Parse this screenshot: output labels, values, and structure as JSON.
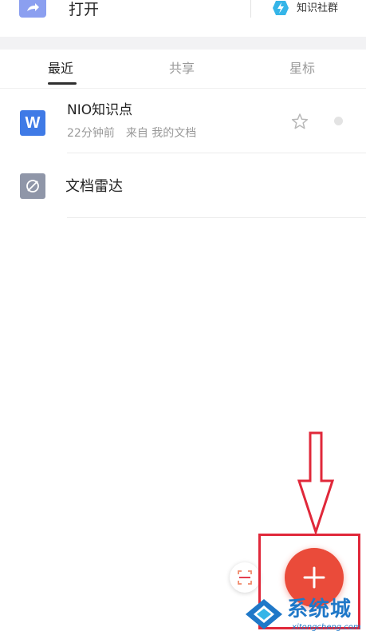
{
  "top_actions": {
    "open_label": "打开",
    "open_icon": "share-arrow-icon",
    "community_label": "知识社群",
    "community_icon": "lightning-icon"
  },
  "tabs": [
    {
      "label": "最近",
      "active": true
    },
    {
      "label": "共享",
      "active": false
    },
    {
      "label": "星标",
      "active": false
    }
  ],
  "files": [
    {
      "icon_letter": "W",
      "icon_color": "#3f7ae6",
      "name": "NIO知识点",
      "time": "22分钟前",
      "source": "来自 我的文档",
      "starred": false
    }
  ],
  "radar": {
    "label": "文档雷达",
    "icon": "satellite-dish-icon",
    "icon_color": "#8f96a8"
  },
  "fab": {
    "icon": "plus-icon",
    "color": "#ea4b3a"
  },
  "scan": {
    "icon": "scan-icon"
  },
  "annotation": {
    "color": "#e0283a"
  },
  "watermark": {
    "name": "系统城",
    "url": "xitongcheng.com",
    "color": "#1f78c8"
  }
}
